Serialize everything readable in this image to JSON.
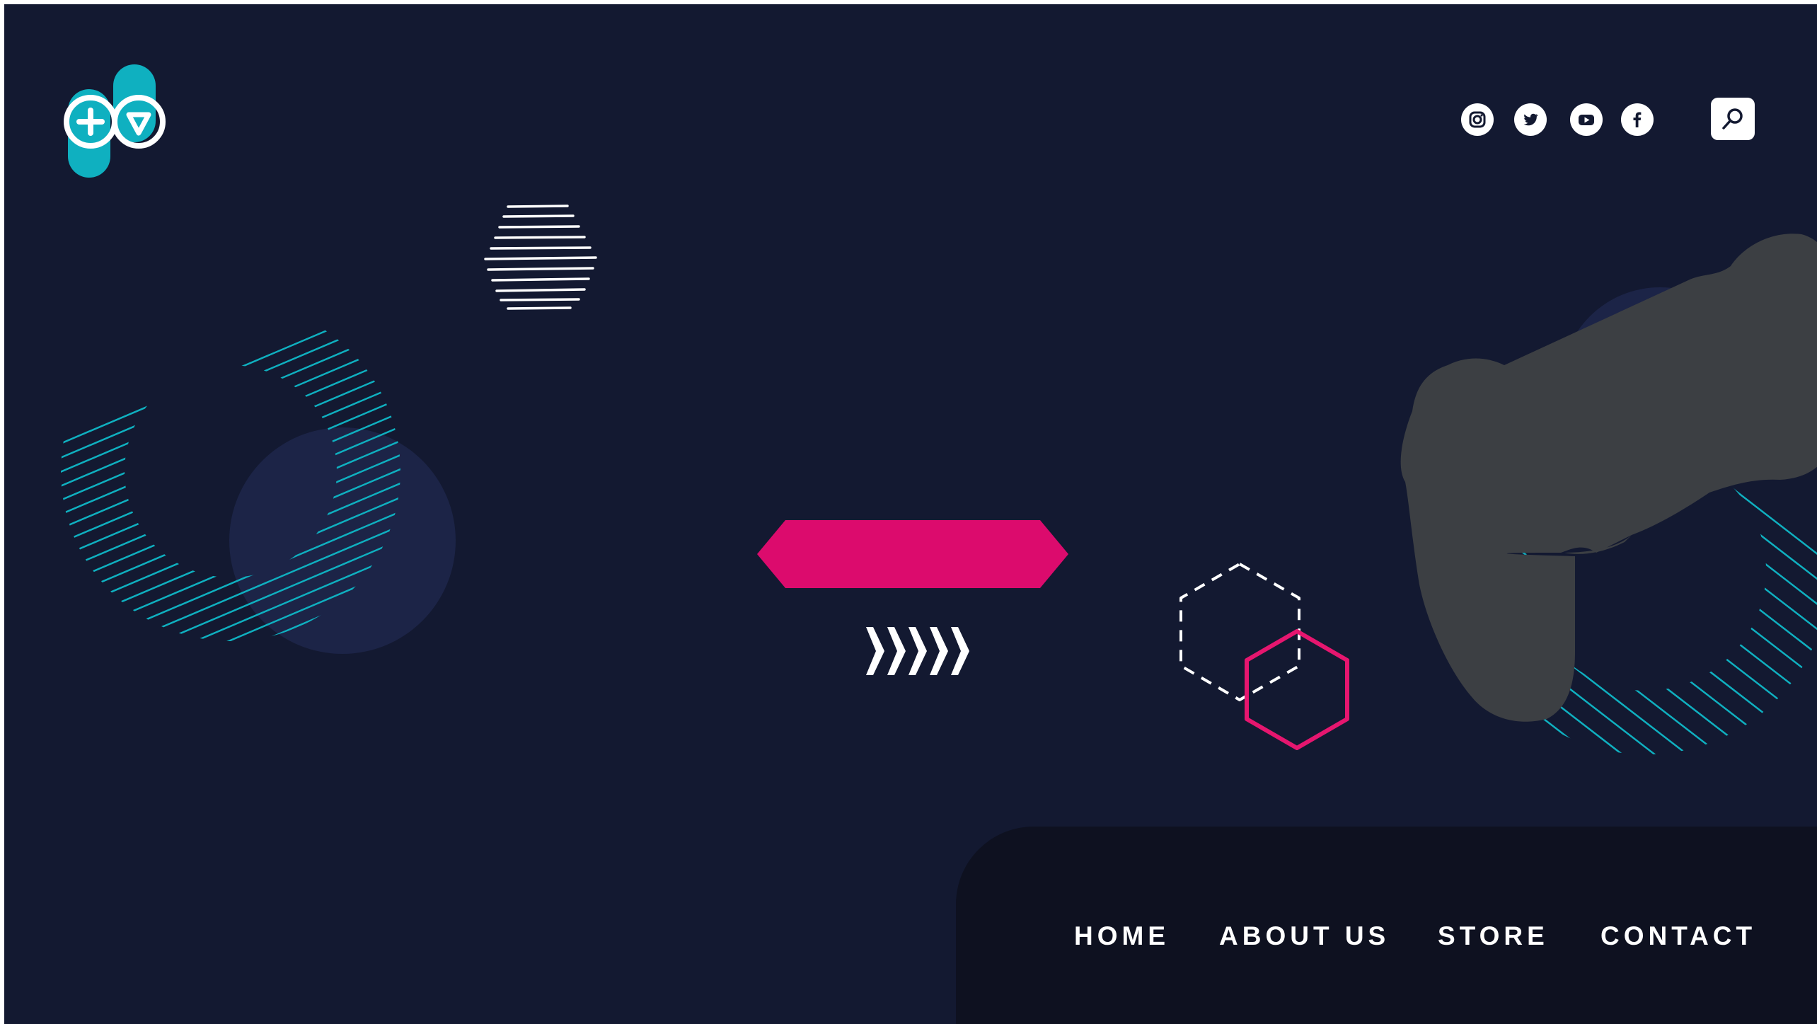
{
  "colors": {
    "background": "#131931",
    "accent_pink": "#dc0b6d",
    "accent_teal": "#0fb0c0",
    "circle_fill": "#1c2447",
    "controller": "#3c3f43",
    "nav_panel": "#0e1120",
    "white": "#ffffff"
  },
  "header": {
    "logo": "plus-triangle-gamepad-logo",
    "social": [
      {
        "name": "instagram",
        "icon": "instagram-icon"
      },
      {
        "name": "twitter",
        "icon": "twitter-icon"
      },
      {
        "name": "youtube",
        "icon": "youtube-icon"
      },
      {
        "name": "facebook",
        "icon": "facebook-icon"
      }
    ],
    "search": {
      "icon": "search-icon"
    }
  },
  "hero": {
    "cta_label": "",
    "arrow_icon": "chevrons-right-icon"
  },
  "nav": {
    "items": [
      {
        "label": "HOME"
      },
      {
        "label": "ABOUT US"
      },
      {
        "label": "STORE"
      },
      {
        "label": "CONTACT"
      }
    ]
  }
}
